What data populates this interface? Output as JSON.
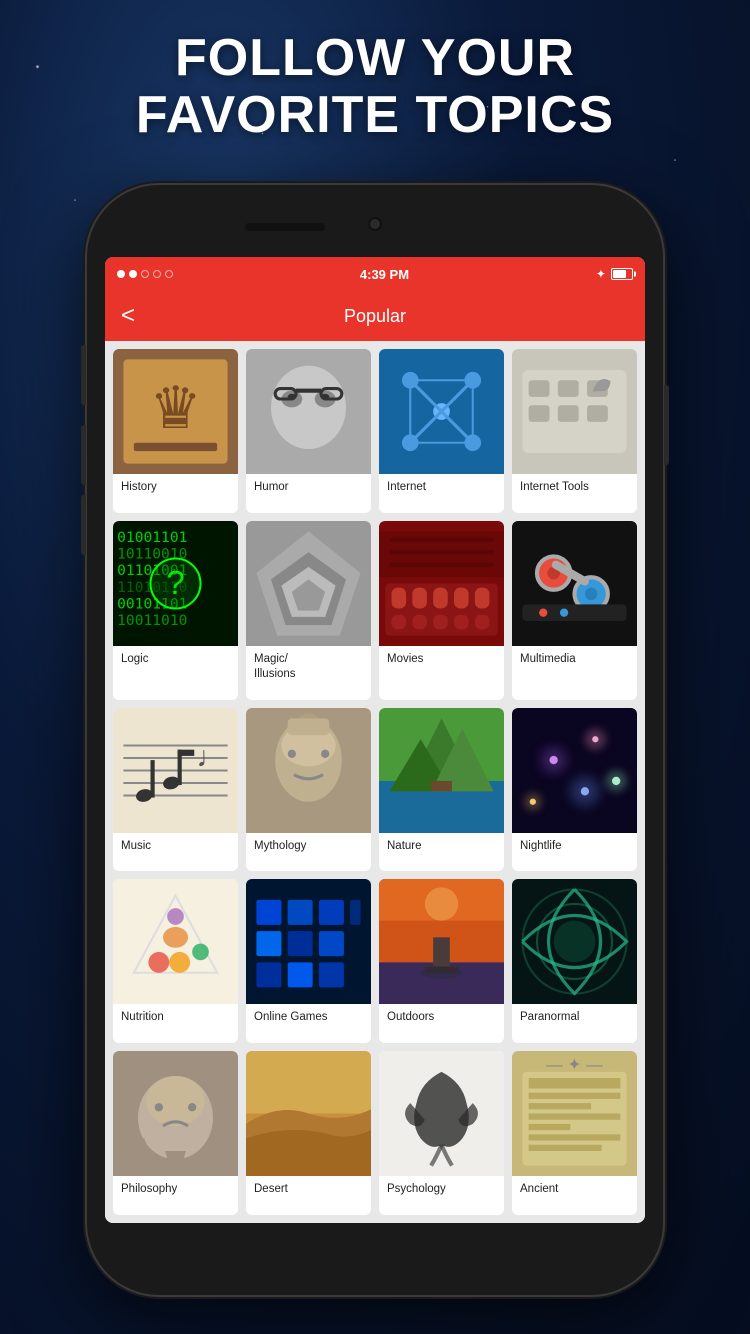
{
  "headline": {
    "line1": "FOLLOW YOUR",
    "line2": "FAVORITE TOPICS"
  },
  "statusBar": {
    "dots": [
      "filled",
      "filled",
      "empty",
      "empty",
      "empty"
    ],
    "time": "4:39 PM",
    "bluetooth": "✦",
    "battery_pct": 75
  },
  "navBar": {
    "back_label": "<",
    "title": "Popular"
  },
  "topics": [
    {
      "id": "history",
      "label": "History",
      "img_class": "img-history",
      "emoji": "👑"
    },
    {
      "id": "humor",
      "label": "Humor",
      "img_class": "img-humor",
      "emoji": "😎"
    },
    {
      "id": "internet",
      "label": "Internet",
      "img_class": "img-internet",
      "emoji": "🔵"
    },
    {
      "id": "internet-tools",
      "label": "Internet Tools",
      "img_class": "img-internet-tools",
      "emoji": "🔧"
    },
    {
      "id": "logic",
      "label": "Logic",
      "img_class": "img-logic",
      "emoji": "👤"
    },
    {
      "id": "magic",
      "label": "Magic/\nIllusions",
      "img_class": "img-magic",
      "emoji": "🎲"
    },
    {
      "id": "movies",
      "label": "Movies",
      "img_class": "img-movies",
      "emoji": "🎬"
    },
    {
      "id": "multimedia",
      "label": "Multimedia",
      "img_class": "img-multimedia",
      "emoji": "🔌"
    },
    {
      "id": "music",
      "label": "Music",
      "img_class": "img-music",
      "emoji": "🎵"
    },
    {
      "id": "mythology",
      "label": "Mythology",
      "img_class": "img-mythology",
      "emoji": "🗿"
    },
    {
      "id": "nature",
      "label": "Nature",
      "img_class": "img-nature",
      "emoji": "🏔"
    },
    {
      "id": "nightlife",
      "label": "Nightlife",
      "img_class": "img-nightlife",
      "emoji": "✨"
    },
    {
      "id": "nutrition",
      "label": "Nutrition",
      "img_class": "img-nutrition",
      "emoji": "🥗"
    },
    {
      "id": "online-games",
      "label": "Online Games",
      "img_class": "img-online-games",
      "emoji": "🎮"
    },
    {
      "id": "outdoors",
      "label": "Outdoors",
      "img_class": "img-outdoors",
      "emoji": "🌅"
    },
    {
      "id": "paranormal",
      "label": "Paranormal",
      "img_class": "img-paranormal",
      "emoji": "🌀"
    },
    {
      "id": "philosophy",
      "label": "Philosophy",
      "img_class": "img-philosophy",
      "emoji": "🤔"
    },
    {
      "id": "desert",
      "label": "Desert",
      "img_class": "img-desert",
      "emoji": "🏜"
    },
    {
      "id": "psychology",
      "label": "Psychology",
      "img_class": "img-rorschach",
      "emoji": "🦋"
    },
    {
      "id": "ancient",
      "label": "Ancient",
      "img_class": "img-stone",
      "emoji": "🏛"
    }
  ]
}
